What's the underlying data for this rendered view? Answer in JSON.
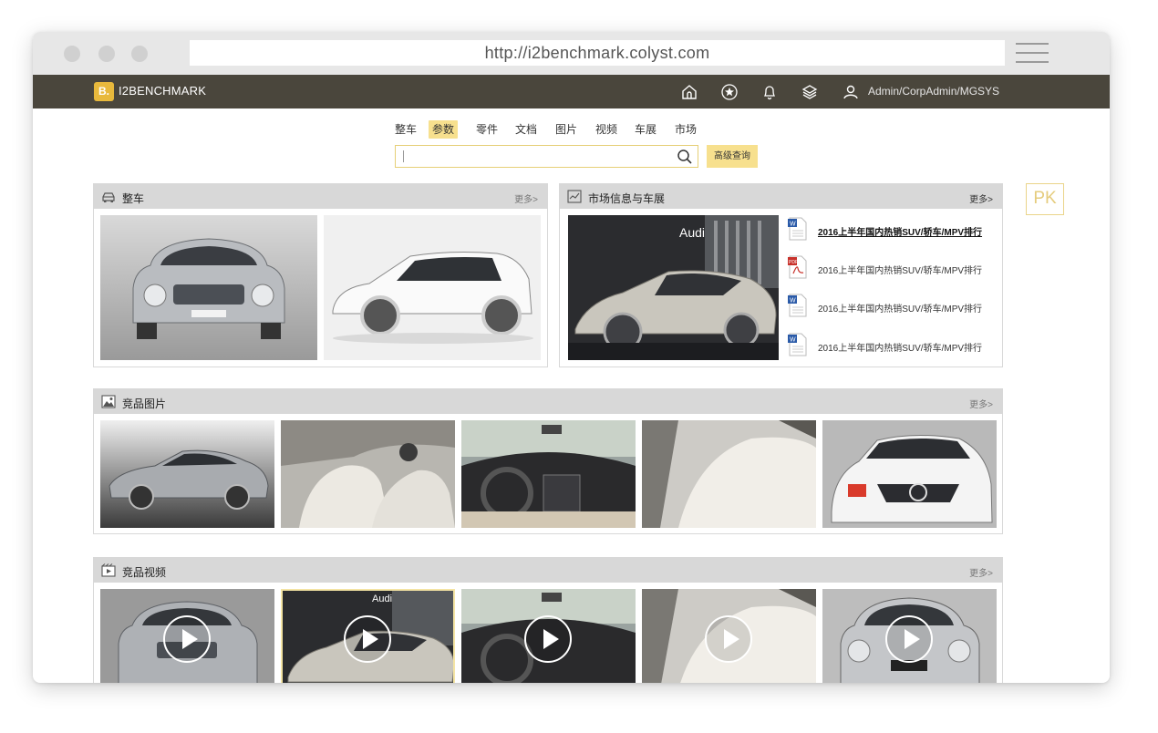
{
  "browser": {
    "url": "http://i2benchmark.colyst.com"
  },
  "app": {
    "logo_mark": "B.",
    "brand": "I2BENCHMARK",
    "user": "Admin/CorpAdmin/MGSYS",
    "header_icons": [
      "home-icon",
      "star-icon",
      "bell-icon",
      "layers-icon",
      "user-icon"
    ]
  },
  "nav": {
    "categories": [
      "整车",
      "参数",
      "零件",
      "文档",
      "图片",
      "视频",
      "车展",
      "市场"
    ],
    "active_index": 1
  },
  "search": {
    "value": "",
    "placeholder": "",
    "advanced_label": "高级查询"
  },
  "pk_label": "PK",
  "sections": {
    "vehicles": {
      "title": "整车",
      "more": "更多>"
    },
    "market": {
      "title": "市场信息与车展",
      "more": "更多>",
      "items": [
        {
          "text": "2016上半年国内热销SUV/轿车/MPV排行",
          "type": "word",
          "highlighted": true
        },
        {
          "text": "2016上半年国内热销SUV/轿车/MPV排行",
          "type": "pdf",
          "highlighted": false
        },
        {
          "text": "2016上半年国内热销SUV/轿车/MPV排行",
          "type": "word",
          "highlighted": false
        },
        {
          "text": "2016上半年国内热销SUV/轿车/MPV排行",
          "type": "word",
          "highlighted": false
        }
      ]
    },
    "images": {
      "title": "竞品图片",
      "more": "更多>"
    },
    "videos": {
      "title": "竞品视频",
      "more": "更多>"
    }
  },
  "colors": {
    "accent": "#f7e08e",
    "header_bg": "#4a463c",
    "logo": "#e8b93c",
    "panel_header": "#d8d8d8"
  }
}
